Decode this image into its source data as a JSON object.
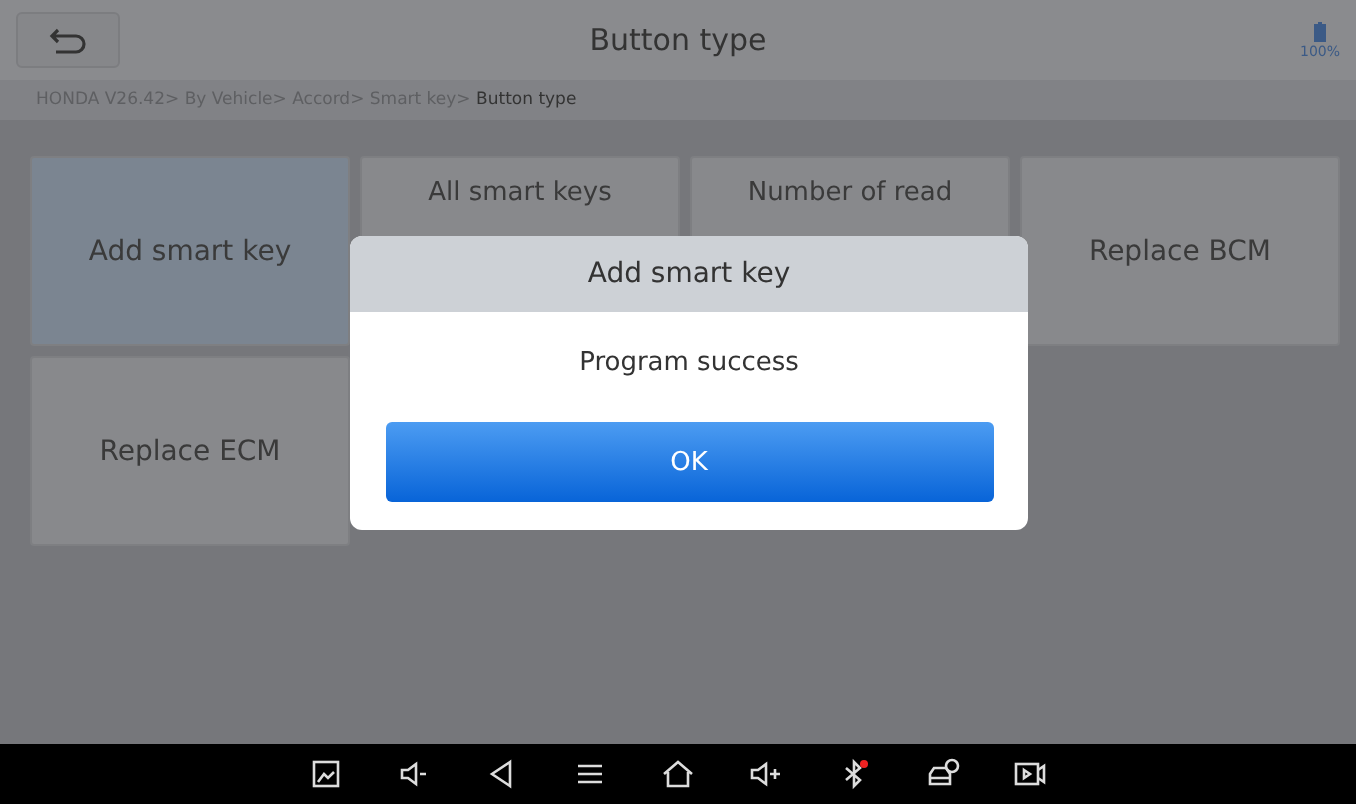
{
  "header": {
    "title": "Button type",
    "battery": "100%"
  },
  "breadcrumb": {
    "path": "HONDA V26.42> By Vehicle> Accord> Smart key> ",
    "current": "Button type"
  },
  "tiles": [
    {
      "label": "Add smart key",
      "selected": true
    },
    {
      "label": "All smart keys",
      "selected": false
    },
    {
      "label": "Number of read",
      "selected": false
    },
    {
      "label": "Replace BCM",
      "selected": false
    },
    {
      "label": "Replace ECM",
      "selected": false
    }
  ],
  "dialog": {
    "title": "Add smart key",
    "message": "Program success",
    "button": "OK"
  }
}
